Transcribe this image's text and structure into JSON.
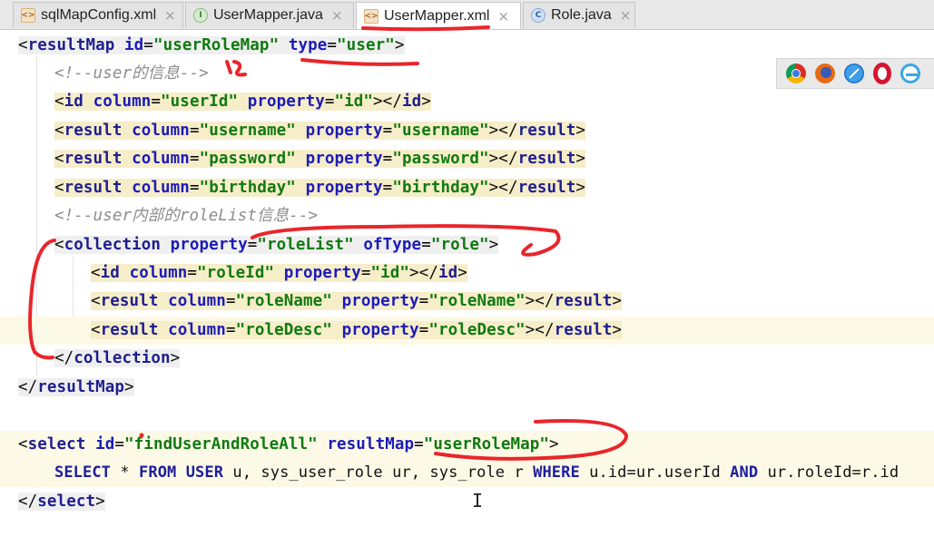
{
  "tabs": [
    {
      "label": "sqlMapConfig.xml",
      "icon": "xml-file-icon",
      "active": false
    },
    {
      "label": "UserMapper.java",
      "icon": "interface-icon",
      "active": false
    },
    {
      "label": "UserMapper.xml",
      "icon": "xml-file-icon",
      "active": true
    },
    {
      "label": "Role.java",
      "icon": "class-icon",
      "active": false
    }
  ],
  "tab_close_glyph": "×",
  "browsers": [
    "chrome-icon",
    "firefox-icon",
    "safari-icon",
    "opera-icon",
    "ie-icon"
  ],
  "code": {
    "l1": {
      "lt": "<",
      "tag": "resultMap",
      "a1": "id",
      "v1": "\"userRoleMap\"",
      "a2": "type",
      "v2": "\"user\"",
      "gt": ">"
    },
    "l2": {
      "text": "<!--user的信息-->"
    },
    "l3": {
      "lt": "<",
      "tag": "id",
      "a1": "column",
      "v1": "\"userId\"",
      "a2": "property",
      "v2": "\"id\"",
      "close": "></",
      "tag2": "id",
      "gt": ">"
    },
    "l4": {
      "lt": "<",
      "tag": "result",
      "a1": "column",
      "v1": "\"username\"",
      "a2": "property",
      "v2": "\"username\"",
      "close": "></",
      "tag2": "result",
      "gt": ">"
    },
    "l5": {
      "lt": "<",
      "tag": "result",
      "a1": "column",
      "v1": "\"password\"",
      "a2": "property",
      "v2": "\"password\"",
      "close": "></",
      "tag2": "result",
      "gt": ">"
    },
    "l6": {
      "lt": "<",
      "tag": "result",
      "a1": "column",
      "v1": "\"birthday\"",
      "a2": "property",
      "v2": "\"birthday\"",
      "close": "></",
      "tag2": "result",
      "gt": ">"
    },
    "l7": {
      "text": "<!--user内部的roleList信息-->"
    },
    "l8": {
      "lt": "<",
      "tag": "collection",
      "a1": "property",
      "v1": "\"roleList\"",
      "a2": "ofType",
      "v2": "\"role\"",
      "gt": ">"
    },
    "l9": {
      "lt": "<",
      "tag": "id",
      "a1": "column",
      "v1": "\"roleId\"",
      "a2": "property",
      "v2": "\"id\"",
      "close": "></",
      "tag2": "id",
      "gt": ">"
    },
    "l10": {
      "lt": "<",
      "tag": "result",
      "a1": "column",
      "v1": "\"roleName\"",
      "a2": "property",
      "v2": "\"roleName\"",
      "close": "></",
      "tag2": "result",
      "gt": ">"
    },
    "l11": {
      "lt": "<",
      "tag": "result",
      "a1": "column",
      "v1": "\"roleDesc\"",
      "a2": "property",
      "v2": "\"roleDesc\"",
      "close": "></",
      "tag2": "result",
      "gt": ">"
    },
    "l12": {
      "lt": "</",
      "tag": "collection",
      "gt": ">"
    },
    "l13": {
      "lt": "</",
      "tag": "resultMap",
      "gt": ">"
    },
    "l15": {
      "lt": "<",
      "tag": "select",
      "a1": "id",
      "v1": "\"findUserAndRoleAll\"",
      "a2": "resultMap",
      "v2": "\"userRoleMap\"",
      "gt": ">"
    },
    "l16": {
      "k1": "SELECT",
      "t1": " * ",
      "k2": "FROM",
      "t2": " ",
      "k3": "USER",
      "t3": " u, sys_user_role ur, sys_role r ",
      "k4": "WHERE",
      "t4": " u.id=ur.userId ",
      "k5": "AND",
      "t5": " ur.roleId=r.id"
    },
    "l17": {
      "lt": "</",
      "tag": "select",
      "gt": ">"
    }
  },
  "colors": {
    "tag": "#1f1f8f",
    "attribute": "#1c1cb8",
    "value": "#107a10",
    "comment": "#8c8c8c",
    "highlight": "#f6edc9",
    "annotation": "#e8262b"
  }
}
